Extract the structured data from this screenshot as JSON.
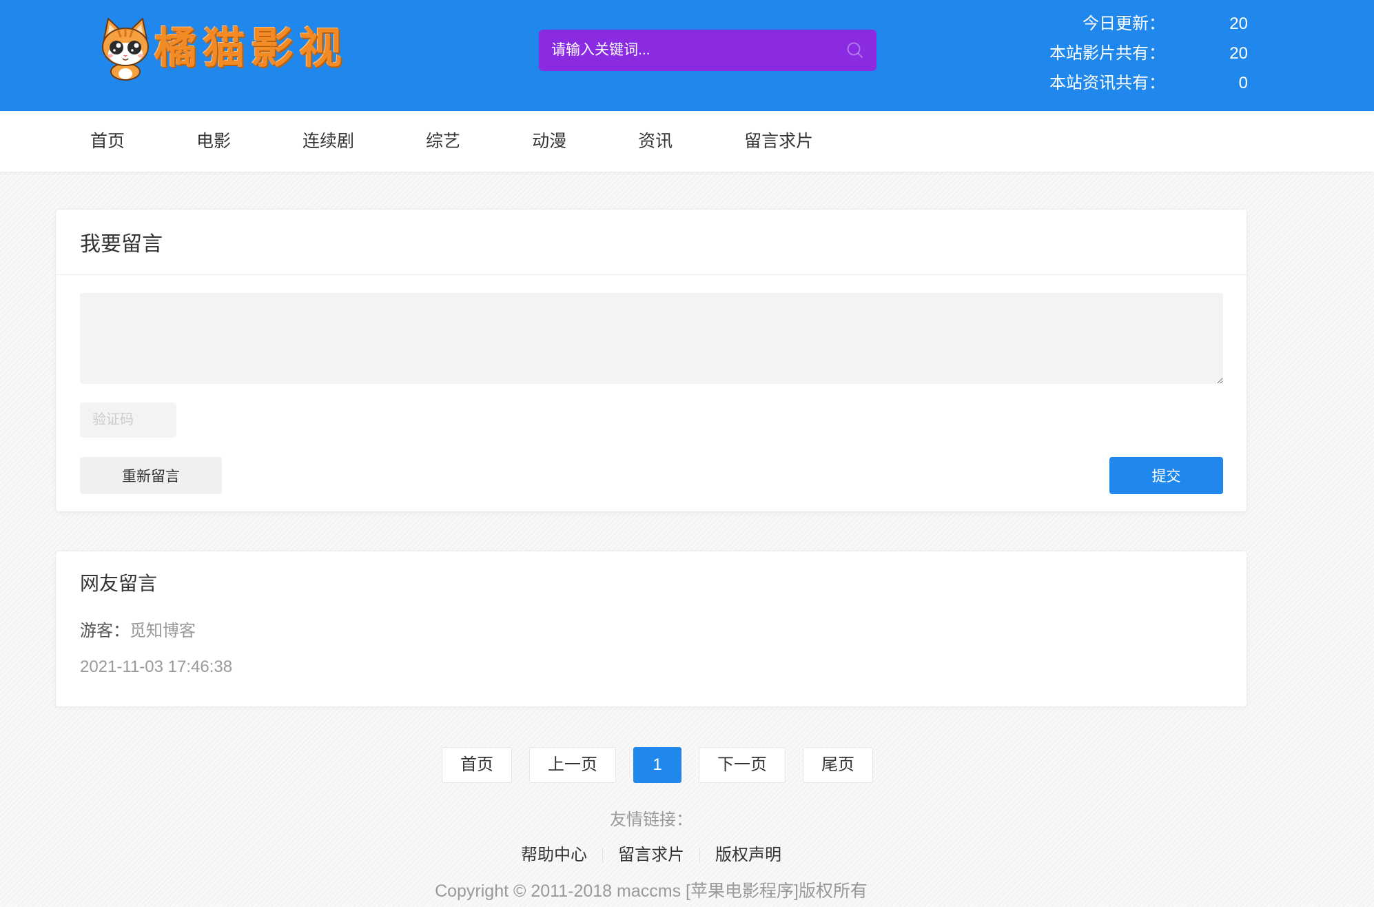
{
  "colors": {
    "primary": "#2088ec",
    "search_bg": "#8a2be2",
    "logo_orange": "#f28a26"
  },
  "header": {
    "logo_text": "橘猫影视",
    "search": {
      "placeholder": "请输入关键词...",
      "icon": "search-icon"
    },
    "stats": [
      {
        "label": "今日更新：",
        "value": "20"
      },
      {
        "label": "本站影片共有：",
        "value": "20"
      },
      {
        "label": "本站资讯共有：",
        "value": "0"
      }
    ]
  },
  "nav": {
    "items": [
      "首页",
      "电影",
      "连续剧",
      "综艺",
      "动漫",
      "资讯",
      "留言求片"
    ]
  },
  "message_form": {
    "title": "我要留言",
    "captcha_placeholder": "验证码",
    "reset_label": "重新留言",
    "submit_label": "提交"
  },
  "messages": {
    "title": "网友留言",
    "items": [
      {
        "user_label": "游客：",
        "user_name": "觅知博客",
        "time": "2021-11-03 17:46:38"
      }
    ]
  },
  "pagination": {
    "first": "首页",
    "prev": "上一页",
    "current": "1",
    "next": "下一页",
    "last": "尾页"
  },
  "footer": {
    "links_label": "友情链接：",
    "links": [
      "帮助中心",
      "留言求片",
      "版权声明"
    ],
    "copyright": "Copyright © 2011-2018 maccms [苹果电影程序]版权所有"
  }
}
